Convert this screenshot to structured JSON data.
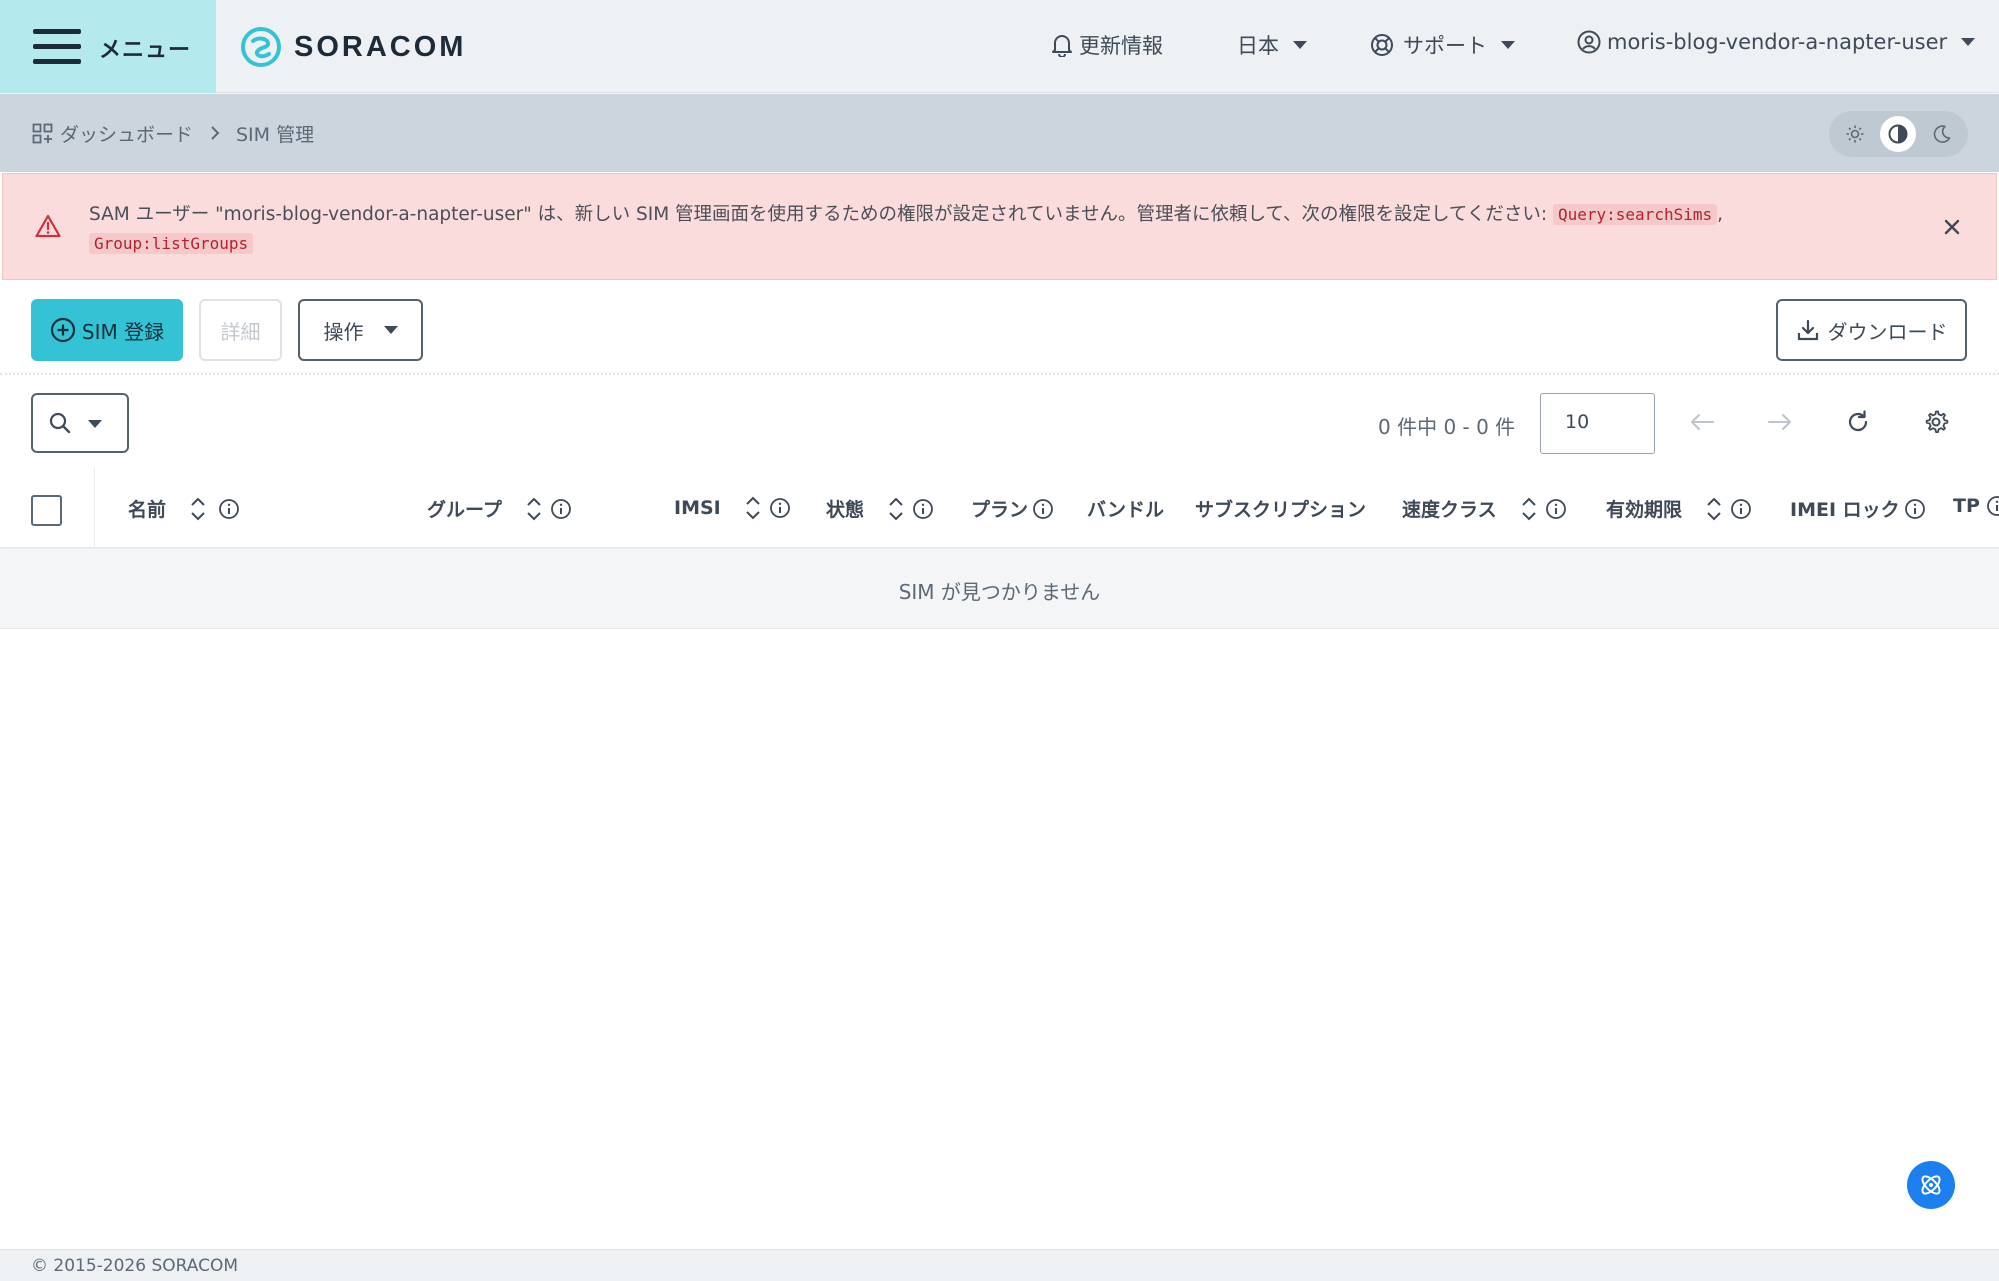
{
  "header": {
    "menu_label": "メニュー",
    "logo_text": "SORACOM",
    "updates_label": "更新情報",
    "region_label": "日本",
    "support_label": "サポート",
    "user_label": "moris-blog-vendor-a-napter-user"
  },
  "breadcrumb": {
    "home_label": "ダッシュボード",
    "current_label": "SIM 管理"
  },
  "theme": {
    "options": [
      "light-icon",
      "auto-contrast-icon",
      "dark-icon"
    ],
    "selected": "auto-contrast-icon"
  },
  "alert": {
    "message": "SAM ユーザー \"moris-blog-vendor-a-napter-user\" は、新しい SIM 管理画面を使用するための権限が設定されていません。管理者に依頼して、次の権限を設定してください: ",
    "permission_1": "Query:searchSims",
    "separator": ",",
    "permission_2": "Group:listGroups"
  },
  "toolbar": {
    "register_label": "SIM 登録",
    "details_label": "詳細",
    "actions_label": "操作",
    "download_label": "ダウンロード"
  },
  "filter": {
    "count_text": "0 件中 0 - 0 件",
    "per_page_value": "10"
  },
  "table": {
    "columns": {
      "name": "名前",
      "group": "グループ",
      "imsi": "IMSI",
      "status": "状態",
      "plan": "プラン",
      "bundle": "バンドル",
      "subscription": "サブスクリプション",
      "speed_class": "速度クラス",
      "expiry": "有効期限",
      "imei_lock": "IMEI ロック",
      "tp": "TP"
    },
    "empty_message": "SIM が見つかりません"
  },
  "footer": {
    "copyright": "© 2015-2026 SORACOM"
  },
  "colors": {
    "brand_teal": "#34c3d4",
    "menu_bg": "#b4e9ee",
    "alert_bg": "#fbdcdc",
    "alert_icon": "#d32f3a",
    "fab_blue": "#1b7ff0"
  }
}
